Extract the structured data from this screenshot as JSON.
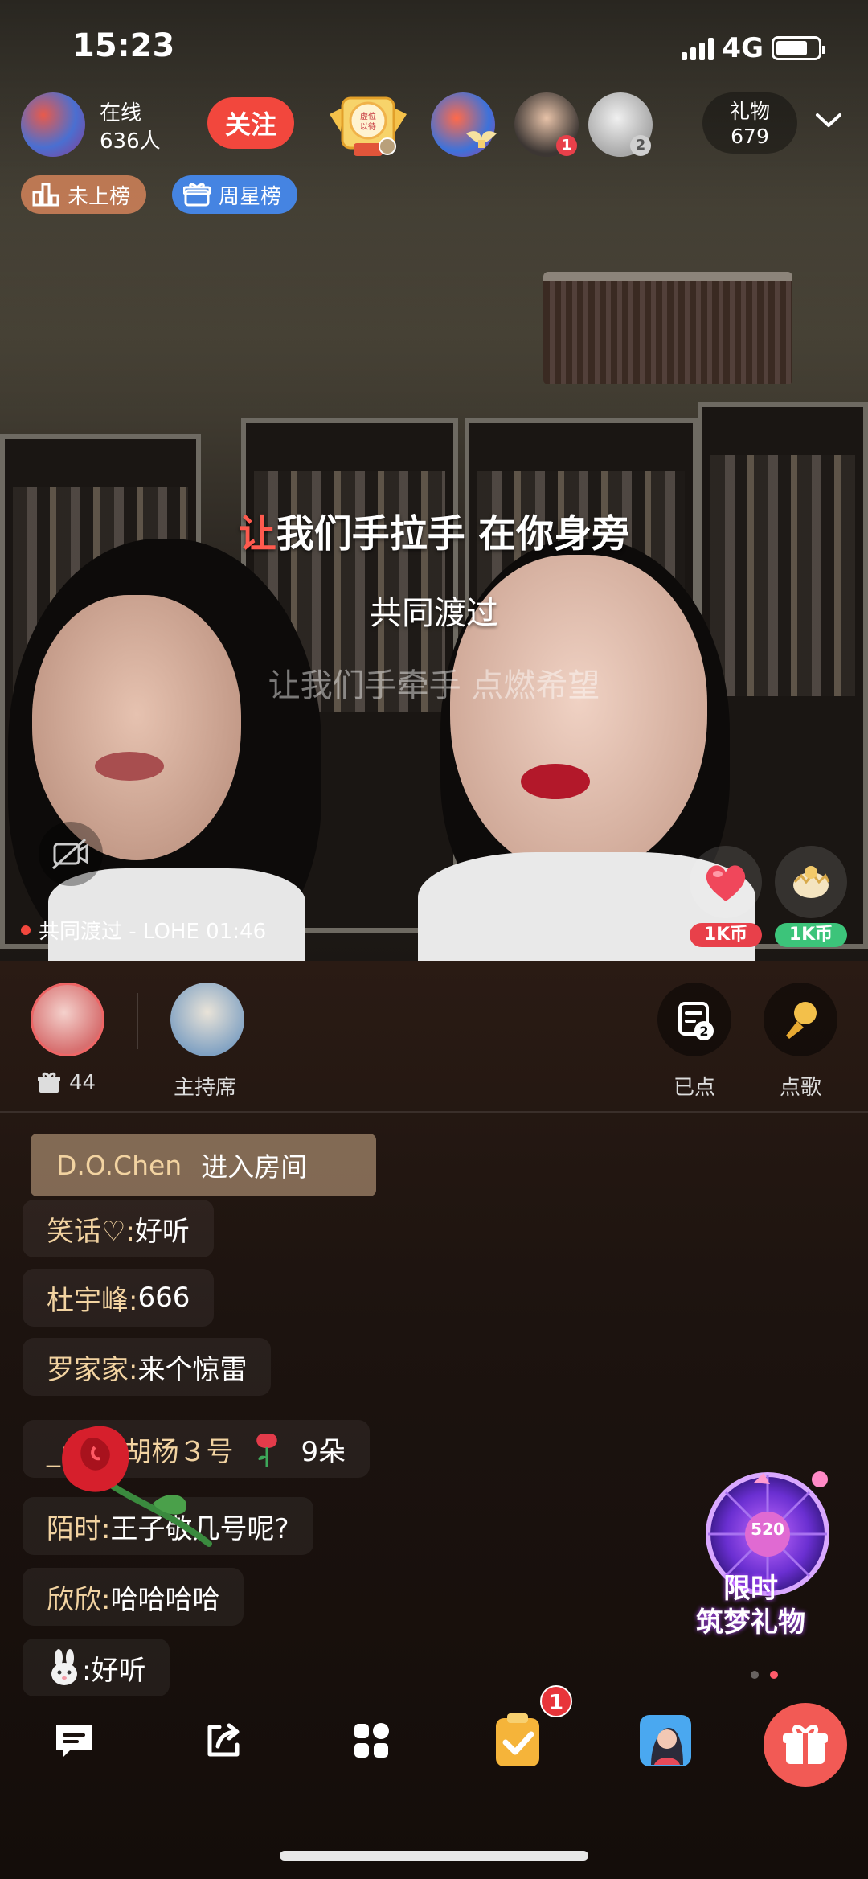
{
  "status_bar": {
    "time": "15:23",
    "network": "4G",
    "battery_level": 0.76
  },
  "top_bar": {
    "online_label": "在线",
    "online_count": "636人",
    "follow_label": "关注",
    "rank_badge_text": "虚位以待",
    "top_fans": [
      {
        "rank": ""
      },
      {
        "rank": "1"
      },
      {
        "rank": "2"
      }
    ],
    "gift_label": "礼物",
    "gift_count": "679"
  },
  "tags": {
    "rank": "未上榜",
    "weekly": "周星榜"
  },
  "lyrics": {
    "current_highlight": "让",
    "current_rest": "我们手拉手 在你身旁",
    "next": "共同渡过",
    "faded": "让我们手牵手 点燃希望"
  },
  "now_playing": "共同渡过 - LOHE 01:46",
  "quick_gifts": [
    {
      "price": "1K币",
      "color": "#e8404a"
    },
    {
      "price": "1K币",
      "color": "#3cc47a"
    }
  ],
  "seats": {
    "gift_count": "44",
    "host_label": "主持席",
    "queued_label": "已点",
    "queued_count": "2",
    "request_label": "点歌"
  },
  "chat": {
    "enter": {
      "user": "D.O.Chen",
      "text": "进入房间"
    },
    "messages": [
      {
        "user": "笑话♡:",
        "text": "好听"
      },
      {
        "user": "杜宇峰:",
        "text": "666"
      },
      {
        "user": "罗家家:",
        "text": "来个惊雷"
      },
      {
        "user": "_:浅浅胡杨３号",
        "text": "9朵"
      },
      {
        "user": "陌时:",
        "text": "王子敬几号呢?"
      },
      {
        "user": "欣欣:",
        "text": "哈哈哈哈"
      },
      {
        "user": "",
        "text": ":好听"
      }
    ]
  },
  "promo": {
    "line1": "限时",
    "line2": "筑梦礼物",
    "wheel_number": "520"
  },
  "toolbar": {
    "task_badge": "1"
  },
  "colors": {
    "accent": "#f2473d",
    "username": "#f2d3a1",
    "weekly_tag": "#468cf5"
  }
}
